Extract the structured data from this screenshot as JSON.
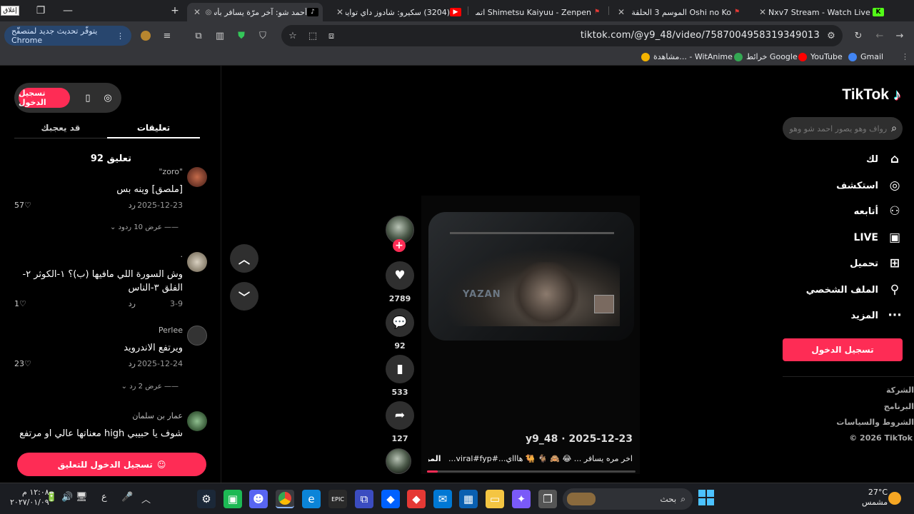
{
  "browser": {
    "tabs": [
      {
        "title": "أحمد شو: آخر مرّة يسافر بأسا",
        "icon": "tiktok-icon",
        "active": true
      },
      {
        "title": "(3204) سكيرو: شادوز داي توايس",
        "icon": "youtube-icon"
      },
      {
        "title": "Shimetsu Kaiyuu - Zenpen اتمي",
        "icon": "bookmark-red-icon"
      },
      {
        "title": "Oshi no Ko الموسم 3 الحلقة",
        "icon": "bookmark-red-icon"
      },
      {
        "title": "Nxv7 Stream - Watch Live on Ki",
        "icon": "kick-icon"
      }
    ],
    "close_label": "إغلاق",
    "update_chip": "يتوفّر تحديث جديد لمتصفّح Chrome",
    "url": "tiktok.com/@y9_48/video/7587004958319349013",
    "bookmarks": [
      {
        "label": "Gmail",
        "color": "#4285f4"
      },
      {
        "label": "YouTube",
        "color": "#ff0000"
      },
      {
        "label": "خرائط Google",
        "color": "#34a853"
      },
      {
        "label": "مشاهدة... - WitAnime",
        "color": "#f4b400"
      }
    ]
  },
  "sidebar": {
    "logo": "TikTok",
    "search_placeholder": "رواف وهو يصور احمد شو وهو ير...",
    "nav": [
      {
        "label": "لك",
        "icon": "home-icon"
      },
      {
        "label": "استكشف",
        "icon": "compass-icon"
      },
      {
        "label": "أتابعه",
        "icon": "following-icon"
      },
      {
        "label": "LIVE",
        "icon": "live-icon"
      },
      {
        "label": "تحميل",
        "icon": "upload-icon"
      },
      {
        "label": "الملف الشخصي",
        "icon": "profile-icon"
      },
      {
        "label": "المزيد",
        "icon": "more-icon"
      }
    ],
    "login_button": "تسجيل الدخول",
    "footer": [
      "الشركة",
      "البرنامج",
      "الشروط والسياسات",
      "© 2026 TikTok"
    ]
  },
  "video": {
    "watermark": "YAZAN",
    "likes": "2789",
    "comments": "92",
    "saves": "533",
    "shares": "127",
    "author": "y9_48",
    "date": "2025-12-23",
    "author_line": "y9_48 · 2025-12-23",
    "description": "اخر مره يسافر ... 😂 🙈 🐐 🐫 هاااي...#viral#fyp...",
    "more": "المزيد",
    "progress": 0.05
  },
  "comments_panel": {
    "login_button": "تسجيل الدخول",
    "tab_comments": "تعليقات",
    "tab_likes": "قد يعجبك",
    "count_line": "92 تعليق",
    "items": [
      {
        "user": "\"zoro\"",
        "text": "[ملصق] وينه بس",
        "date": "2025-12-23",
        "reply": "رد",
        "likes": "57",
        "view_replies": "عرض 10 ردود"
      },
      {
        "user": "·",
        "text": "وش السورة اللي مافيها (ب)؟ ١-الكوثر ٢-الفلق ٣-الناس",
        "date": "3-9",
        "reply": "رد",
        "likes": "1"
      },
      {
        "user": "Perlee",
        "text": "ويرتفع الاندرويد",
        "date": "2025-12-24",
        "reply": "رد",
        "likes": "23",
        "view_replies": "عرض 2 رد"
      },
      {
        "user": "عمار بن سلمان",
        "text": "شوف يا حبيبي high معناتها عالي او مرتفع"
      }
    ],
    "cta": "تسجيل الدخول للتعليق"
  },
  "taskbar": {
    "search": "بحث",
    "temp": "27°C",
    "weather": "مشمس",
    "time": "١٢:٠٨ م",
    "date": "٢٠٢٧/٠١/٠٩",
    "lang": "ع"
  }
}
